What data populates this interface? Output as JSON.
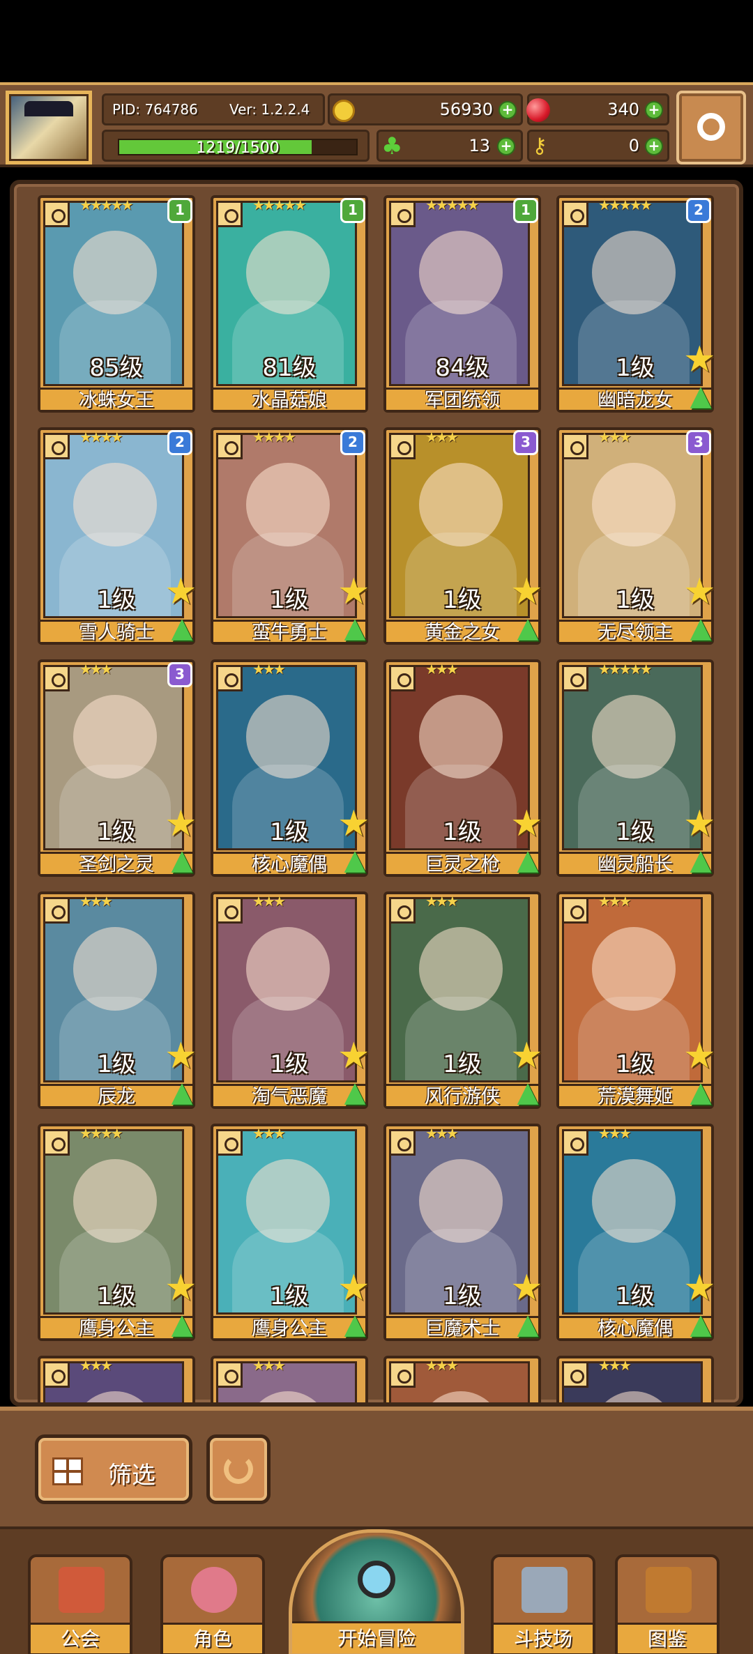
{
  "hud": {
    "pid": "PID: 764786",
    "version": "Ver: 1.2.2.4",
    "gold": "56930",
    "gems": "340",
    "xp_text": "1219/1500",
    "xp_progress": 0.813,
    "clovers": "13",
    "keys": "0"
  },
  "colors": {
    "rank_green": "#4fa83a",
    "rank_blue": "#3a7ad8",
    "rank_purple": "#8a5ad0",
    "accent_gold": "#e8a83e"
  },
  "heroes": [
    {
      "name": "冰蛛女王",
      "level": "85级",
      "stars": "★★★★★",
      "rank": "1",
      "rank_color": "green",
      "bg": "#5a9ab0",
      "show_up": false
    },
    {
      "name": "水晶菇娘",
      "level": "81级",
      "stars": "★★★★★",
      "rank": "1",
      "rank_color": "green",
      "bg": "#3ab0a0",
      "show_up": false
    },
    {
      "name": "军团统领",
      "level": "84级",
      "stars": "★★★★★",
      "rank": "1",
      "rank_color": "green",
      "bg": "#6a5a8a",
      "show_up": false
    },
    {
      "name": "幽暗龙女",
      "level": "1级",
      "stars": "★★★★★",
      "rank": "2",
      "rank_color": "blue",
      "bg": "#2e5a7a",
      "show_up": true
    },
    {
      "name": "雪人骑士",
      "level": "1级",
      "stars": "★★★★",
      "rank": "2",
      "rank_color": "blue",
      "bg": "#8ab6d0",
      "show_up": true
    },
    {
      "name": "蛮牛勇士",
      "level": "1级",
      "stars": "★★★★",
      "rank": "2",
      "rank_color": "blue",
      "bg": "#b07a6a",
      "show_up": true
    },
    {
      "name": "黄金之女",
      "level": "1级",
      "stars": "★★★",
      "rank": "3",
      "rank_color": "purple",
      "bg": "#b8902a",
      "show_up": true
    },
    {
      "name": "无尽领主",
      "level": "1级",
      "stars": "★★★",
      "rank": "3",
      "rank_color": "purple",
      "bg": "#d0b07a",
      "show_up": true
    },
    {
      "name": "圣剑之灵",
      "level": "1级",
      "stars": "★★★",
      "rank": "3",
      "rank_color": "purple",
      "bg": "#a89a80",
      "show_up": true
    },
    {
      "name": "核心魔偶",
      "level": "1级",
      "stars": "★★★",
      "rank": "",
      "rank_color": "",
      "bg": "#2a6a8a",
      "show_up": true
    },
    {
      "name": "巨灵之枪",
      "level": "1级",
      "stars": "★★★",
      "rank": "",
      "rank_color": "",
      "bg": "#7a3a2a",
      "show_up": true
    },
    {
      "name": "幽灵船长",
      "level": "1级",
      "stars": "★★★★★",
      "rank": "",
      "rank_color": "",
      "bg": "#4a6a5a",
      "show_up": true
    },
    {
      "name": "辰龙",
      "level": "1级",
      "stars": "★★★",
      "rank": "",
      "rank_color": "",
      "bg": "#5a8aa0",
      "show_up": true
    },
    {
      "name": "淘气恶魔",
      "level": "1级",
      "stars": "★★★",
      "rank": "",
      "rank_color": "",
      "bg": "#8a5a6a",
      "show_up": true
    },
    {
      "name": "风行游侠",
      "level": "1级",
      "stars": "★★★",
      "rank": "",
      "rank_color": "",
      "bg": "#4a6a4a",
      "show_up": true
    },
    {
      "name": "荒漠舞姬",
      "level": "1级",
      "stars": "★★★",
      "rank": "",
      "rank_color": "",
      "bg": "#c06a3a",
      "show_up": true
    },
    {
      "name": "鹰身公主",
      "level": "1级",
      "stars": "★★★★",
      "rank": "",
      "rank_color": "",
      "bg": "#7a8a6a",
      "show_up": true
    },
    {
      "name": "鹰身公主",
      "level": "1级",
      "stars": "★★★",
      "rank": "",
      "rank_color": "",
      "bg": "#4ab0b8",
      "show_up": true
    },
    {
      "name": "巨魔术士",
      "level": "1级",
      "stars": "★★★",
      "rank": "",
      "rank_color": "",
      "bg": "#6a6a8a",
      "show_up": true
    },
    {
      "name": "核心魔偶",
      "level": "1级",
      "stars": "★★★",
      "rank": "",
      "rank_color": "",
      "bg": "#2a7a9a",
      "show_up": true
    },
    {
      "name": "",
      "level": "",
      "stars": "★★★",
      "rank": "",
      "rank_color": "",
      "bg": "#5a4a7a",
      "show_up": false
    },
    {
      "name": "",
      "level": "",
      "stars": "★★★",
      "rank": "",
      "rank_color": "",
      "bg": "#8a6a8a",
      "show_up": false
    },
    {
      "name": "",
      "level": "",
      "stars": "★★★",
      "rank": "",
      "rank_color": "",
      "bg": "#a05a3a",
      "show_up": false
    },
    {
      "name": "",
      "level": "",
      "stars": "★★★",
      "rank": "",
      "rank_color": "",
      "bg": "#3a3a5a",
      "show_up": false
    }
  ],
  "filter": {
    "label": "筛选"
  },
  "nav": {
    "guild": "公会",
    "heroes": "角色",
    "adventure": "开始冒险",
    "arena": "斗技场",
    "codex": "图鉴"
  }
}
